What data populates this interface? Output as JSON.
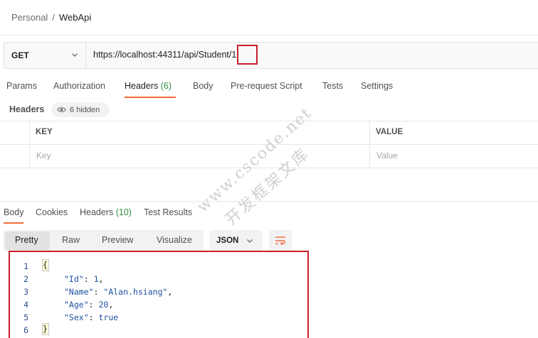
{
  "breadcrumb": {
    "workspace": "Personal",
    "separator": "/",
    "collection": "WebApi"
  },
  "request": {
    "method": "GET",
    "url": "https://localhost:44311/api/Student/1"
  },
  "request_tabs": {
    "params": "Params",
    "authorization": "Authorization",
    "headers": "Headers",
    "headers_count": "(6)",
    "body": "Body",
    "pre_request": "Pre-request Script",
    "tests": "Tests",
    "settings": "Settings"
  },
  "headers_section": {
    "title": "Headers",
    "hidden_label": "6 hidden",
    "col_key": "KEY",
    "col_value": "VALUE",
    "key_placeholder": "Key",
    "value_placeholder": "Value"
  },
  "response_tabs": {
    "body": "Body",
    "cookies": "Cookies",
    "headers": "Headers",
    "headers_count": "(10)",
    "test_results": "Test Results"
  },
  "view_modes": {
    "pretty": "Pretty",
    "raw": "Raw",
    "preview": "Preview",
    "visualize": "Visualize",
    "format": "JSON"
  },
  "response_body": {
    "line_numbers": [
      "1",
      "2",
      "3",
      "4",
      "5",
      "6"
    ],
    "open_brace": "{",
    "close_brace": "}",
    "fields": [
      {
        "key": "\"Id\"",
        "value": "1",
        "type": "number"
      },
      {
        "key": "\"Name\"",
        "value": "\"Alan.hsiang\"",
        "type": "string"
      },
      {
        "key": "\"Age\"",
        "value": "20",
        "type": "number"
      },
      {
        "key": "\"Sex\"",
        "value": "true",
        "type": "boolean"
      }
    ]
  },
  "watermark": {
    "line1": "www.cscode.net",
    "line2": "开发框架文库"
  },
  "colors": {
    "accent": "#f26b3a",
    "highlight_box": "#c8202a",
    "count_green": "#2c8a3e",
    "json_value": "#1d4f9f"
  },
  "icons": {
    "method_dropdown": "chevron-down-icon",
    "hidden_headers": "eye-icon",
    "format_dropdown": "chevron-down-icon",
    "wrap": "wrap-lines-icon"
  }
}
